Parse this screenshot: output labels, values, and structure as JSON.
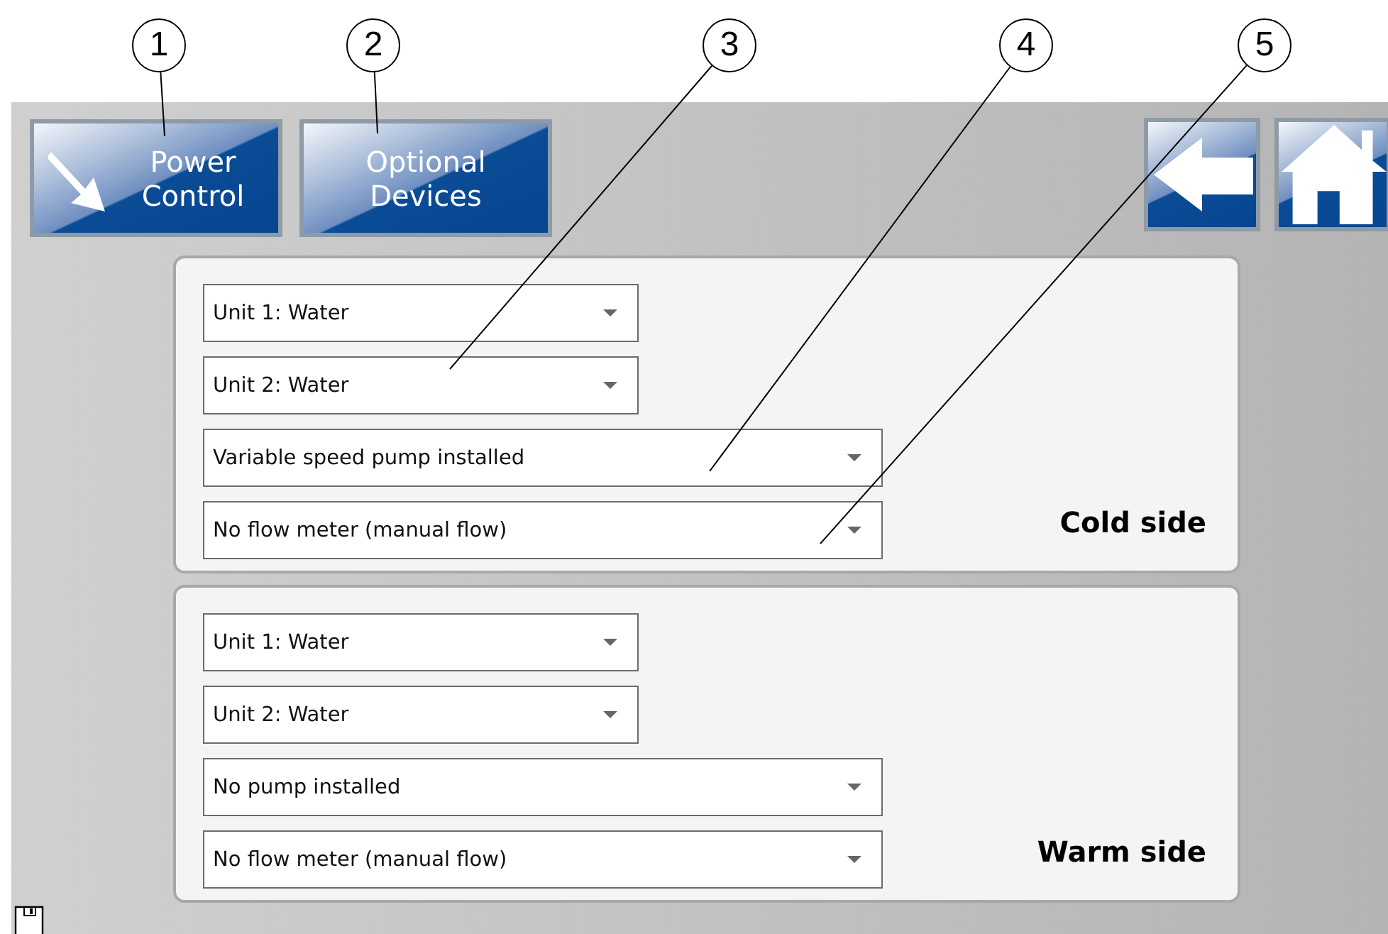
{
  "callouts": [
    {
      "number": "1"
    },
    {
      "number": "2"
    },
    {
      "number": "3"
    },
    {
      "number": "4"
    },
    {
      "number": "5"
    }
  ],
  "nav_buttons": [
    {
      "label": "Power Control",
      "kind": "arrow"
    },
    {
      "label": "Optional Devices",
      "kind": "plain"
    }
  ],
  "icon_buttons": [
    {
      "kind": "back"
    },
    {
      "kind": "home"
    }
  ],
  "panels": [
    {
      "label": "Cold side",
      "selects": [
        {
          "value": "Unit 1: Water",
          "kind": "short"
        },
        {
          "value": "Unit 2: Water",
          "kind": "short"
        },
        {
          "value": "Variable speed pump installed",
          "kind": "long"
        },
        {
          "value": "No flow meter (manual flow)",
          "kind": "long"
        }
      ]
    },
    {
      "label": "Warm side",
      "selects": [
        {
          "value": "Unit 1: Water",
          "kind": "short"
        },
        {
          "value": "Unit 2: Water",
          "kind": "short"
        },
        {
          "value": "No pump installed",
          "kind": "long"
        },
        {
          "value": "No flow meter (manual flow)",
          "kind": "long"
        }
      ]
    }
  ]
}
